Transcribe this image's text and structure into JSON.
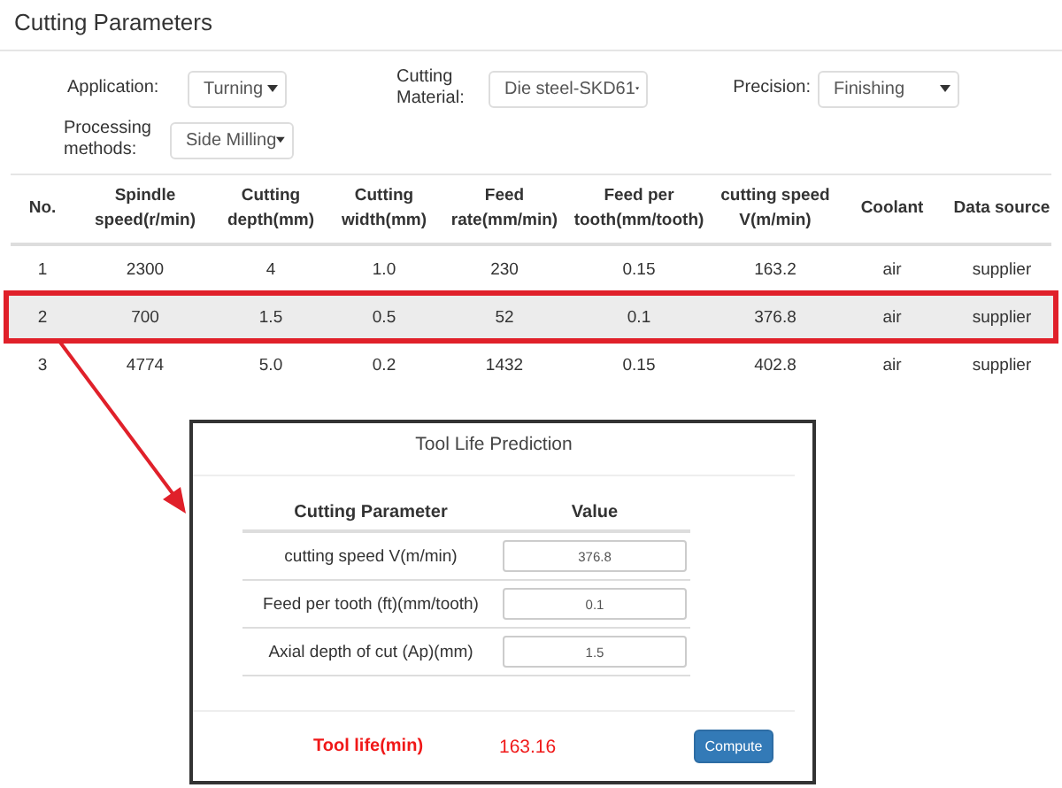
{
  "header": {
    "title": "Cutting Parameters"
  },
  "filters": [
    {
      "label": "Application:",
      "value": "Turning"
    },
    {
      "label": "Cutting Material:",
      "value": "Die steel-SKD61"
    },
    {
      "label": "Precision:",
      "value": "Finishing"
    },
    {
      "label": "Processing methods:",
      "value": "Side Milling"
    }
  ],
  "table": {
    "columns": [
      "No.",
      "Spindle speed(r/min)",
      "Cutting depth(mm)",
      "Cutting width(mm)",
      "Feed rate(mm/min)",
      "Feed per tooth(mm/tooth)",
      "cutting speed V(m/min)",
      "Coolant",
      "Data source"
    ],
    "rows": [
      {
        "selected": false,
        "cells": [
          "1",
          "2300",
          "4",
          "1.0",
          "230",
          "0.15",
          "163.2",
          "air",
          "supplier"
        ]
      },
      {
        "selected": true,
        "cells": [
          "2",
          "700",
          "1.5",
          "0.5",
          "52",
          "0.1",
          "376.8",
          "air",
          "supplier"
        ]
      },
      {
        "selected": false,
        "cells": [
          "3",
          "4774",
          "5.0",
          "0.2",
          "1432",
          "0.15",
          "402.8",
          "air",
          "supplier"
        ]
      }
    ]
  },
  "dialog": {
    "title": "Tool Life Prediction",
    "columns": [
      "Cutting Parameter",
      "Value"
    ],
    "params": [
      {
        "label": "cutting speed V(m/min)",
        "value": "376.8"
      },
      {
        "label": "Feed per tooth (ft)(mm/tooth)",
        "value": "0.1"
      },
      {
        "label": "Axial depth of cut (Ap)(mm)",
        "value": "1.5"
      }
    ],
    "result_label": "Tool life(min)",
    "result_value": "163.16",
    "button": "Compute"
  }
}
